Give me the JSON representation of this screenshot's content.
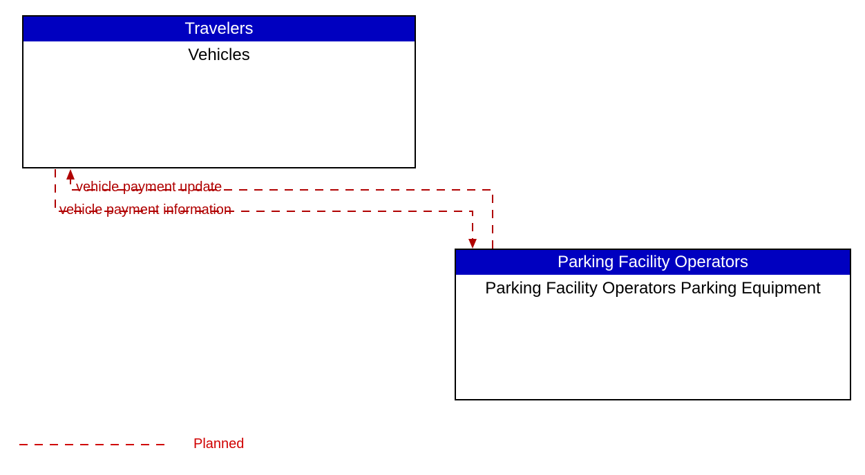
{
  "entities": {
    "travelers": {
      "header": "Travelers",
      "body": "Vehicles"
    },
    "parking": {
      "header": "Parking Facility Operators",
      "body": "Parking Facility Operators Parking Equipment"
    }
  },
  "flows": {
    "upper": "vehicle payment update",
    "lower": "vehicle payment information"
  },
  "legend": {
    "planned": "Planned"
  }
}
